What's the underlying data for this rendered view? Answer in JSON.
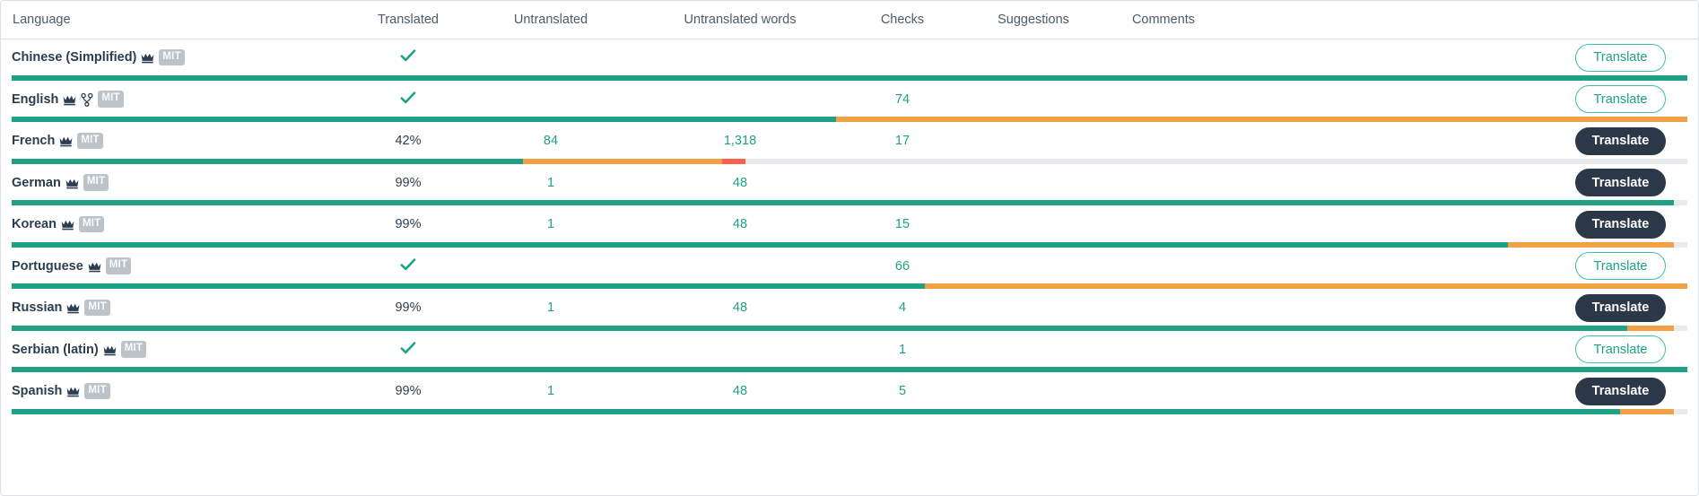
{
  "colors": {
    "green": "#1fa185",
    "orange": "#f2a046",
    "red": "#f8604d",
    "gray": "#e8eaec",
    "dark": "#2b3847",
    "badge_gray": "#bcc3c9",
    "header_text": "#4a5c6b"
  },
  "table": {
    "columns": [
      {
        "key": "language",
        "label": "Language"
      },
      {
        "key": "translated",
        "label": "Translated"
      },
      {
        "key": "untranslated",
        "label": "Untranslated"
      },
      {
        "key": "untranslated_words",
        "label": "Untranslated words"
      },
      {
        "key": "checks",
        "label": "Checks"
      },
      {
        "key": "suggestions",
        "label": "Suggestions"
      },
      {
        "key": "comments",
        "label": "Comments"
      }
    ],
    "rows": [
      {
        "language": "Chinese (Simplified)",
        "icons": [
          "crown-icon"
        ],
        "license": "MIT",
        "translated": "",
        "translated_complete": true,
        "untranslated": "",
        "untranslated_words": "",
        "checks": "",
        "suggestions": "",
        "comments": "",
        "action": {
          "label": "Translate",
          "style": "outline"
        },
        "progress": [
          {
            "type": "green",
            "pct": 100
          }
        ]
      },
      {
        "language": "English",
        "icons": [
          "crown-icon",
          "source-language-icon"
        ],
        "license": "MIT",
        "translated": "",
        "translated_complete": true,
        "untranslated": "",
        "untranslated_words": "",
        "checks": "74",
        "suggestions": "",
        "comments": "",
        "action": {
          "label": "Translate",
          "style": "outline"
        },
        "progress": [
          {
            "type": "green",
            "pct": 49.2
          },
          {
            "type": "orange",
            "pct": 50.8
          }
        ]
      },
      {
        "language": "French",
        "icons": [
          "crown-icon"
        ],
        "license": "MIT",
        "translated": "42%",
        "translated_complete": false,
        "untranslated": "84",
        "untranslated_words": "1,318",
        "checks": "17",
        "suggestions": "",
        "comments": "",
        "action": {
          "label": "Translate",
          "style": "solid"
        },
        "progress": [
          {
            "type": "green",
            "pct": 30.5
          },
          {
            "type": "orange",
            "pct": 11.9
          },
          {
            "type": "red",
            "pct": 1.4
          },
          {
            "type": "gray",
            "pct": 56.2
          }
        ]
      },
      {
        "language": "German",
        "icons": [
          "crown-icon"
        ],
        "license": "MIT",
        "translated": "99%",
        "translated_complete": false,
        "untranslated": "1",
        "untranslated_words": "48",
        "checks": "",
        "suggestions": "",
        "comments": "",
        "action": {
          "label": "Translate",
          "style": "solid"
        },
        "progress": [
          {
            "type": "green",
            "pct": 99.2
          },
          {
            "type": "gray",
            "pct": 0.8
          }
        ]
      },
      {
        "language": "Korean",
        "icons": [
          "crown-icon"
        ],
        "license": "MIT",
        "translated": "99%",
        "translated_complete": false,
        "untranslated": "1",
        "untranslated_words": "48",
        "checks": "15",
        "suggestions": "",
        "comments": "",
        "action": {
          "label": "Translate",
          "style": "solid"
        },
        "progress": [
          {
            "type": "green",
            "pct": 89.3
          },
          {
            "type": "orange",
            "pct": 9.9
          },
          {
            "type": "gray",
            "pct": 0.8
          }
        ]
      },
      {
        "language": "Portuguese",
        "icons": [
          "crown-icon"
        ],
        "license": "MIT",
        "translated": "",
        "translated_complete": true,
        "untranslated": "",
        "untranslated_words": "",
        "checks": "66",
        "suggestions": "",
        "comments": "",
        "action": {
          "label": "Translate",
          "style": "outline"
        },
        "progress": [
          {
            "type": "green",
            "pct": 54.5
          },
          {
            "type": "orange",
            "pct": 45.5
          }
        ]
      },
      {
        "language": "Russian",
        "icons": [
          "crown-icon"
        ],
        "license": "MIT",
        "translated": "99%",
        "translated_complete": false,
        "untranslated": "1",
        "untranslated_words": "48",
        "checks": "4",
        "suggestions": "",
        "comments": "",
        "action": {
          "label": "Translate",
          "style": "solid"
        },
        "progress": [
          {
            "type": "green",
            "pct": 96.4
          },
          {
            "type": "orange",
            "pct": 2.8
          },
          {
            "type": "gray",
            "pct": 0.8
          }
        ]
      },
      {
        "language": "Serbian (latin)",
        "icons": [
          "crown-icon"
        ],
        "license": "MIT",
        "translated": "",
        "translated_complete": true,
        "untranslated": "",
        "untranslated_words": "",
        "checks": "1",
        "suggestions": "",
        "comments": "",
        "action": {
          "label": "Translate",
          "style": "outline"
        },
        "progress": [
          {
            "type": "green",
            "pct": 100
          }
        ]
      },
      {
        "language": "Spanish",
        "icons": [
          "crown-icon"
        ],
        "license": "MIT",
        "translated": "99%",
        "translated_complete": false,
        "untranslated": "1",
        "untranslated_words": "48",
        "checks": "5",
        "suggestions": "",
        "comments": "",
        "action": {
          "label": "Translate",
          "style": "solid"
        },
        "progress": [
          {
            "type": "green",
            "pct": 96.0
          },
          {
            "type": "orange",
            "pct": 3.2
          },
          {
            "type": "gray",
            "pct": 0.8
          }
        ]
      }
    ]
  }
}
